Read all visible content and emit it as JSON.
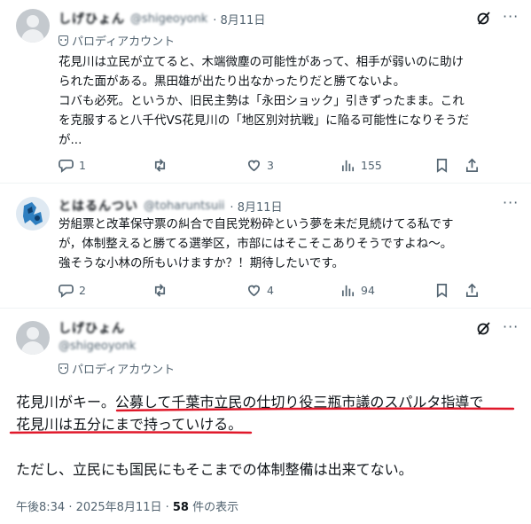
{
  "tweet1": {
    "name": "しげひょん",
    "handle": "@shigeoyonk",
    "date": "8月11日",
    "parody_label": "パロディアカウント",
    "text": "花見川は立民が立てると、木端微塵の可能性があって、相手が弱いのに助け\nられた面がある。黒田雄が出たり出なかったりだと勝てないよ。\nコバも必死。というか、旧民主勢は「永田ショック」引きずったまま。これ\nを克服すると八千代VS花見川の「地区別対抗戦」に陥る可能性になりそうだ\nが...",
    "replies": "1",
    "retweets": "",
    "likes": "3",
    "views": "155"
  },
  "tweet2": {
    "name": "とはるんつい",
    "handle": "@toharuntsuii",
    "date": "8月11日",
    "text": "労組票と改革保守票の糾合で自民党粉砕という夢を未だ見続けてる私です\nが，体制整えると勝てる選挙区，市部にはそこそこありそうですよね〜。\n強そうな小林の所もいけますか？！期待したいです。",
    "replies": "2",
    "retweets": "",
    "likes": "4",
    "views": "94"
  },
  "main_tweet": {
    "name": "しげひょん",
    "handle": "@shigeoyonk",
    "parody_label": "パロディアカウント",
    "line1_prefix": "花見川がキー。",
    "line1_underlined": "公募して千葉市立民の仕切り役三瓶市議のスパルタ指導で",
    "line2_underlined": "花見川は五分にまで持っていける。",
    "line3": "ただし、立民にも国民にもそこまでの体制整備は出来てない。",
    "timestamp": "午後8:34 · 2025年8月11日 · ",
    "views_count": "58",
    "views_label": " 件の表示"
  },
  "colors": {
    "underline": "#e0182a",
    "text": "#0f1419",
    "secondary": "#536471"
  }
}
